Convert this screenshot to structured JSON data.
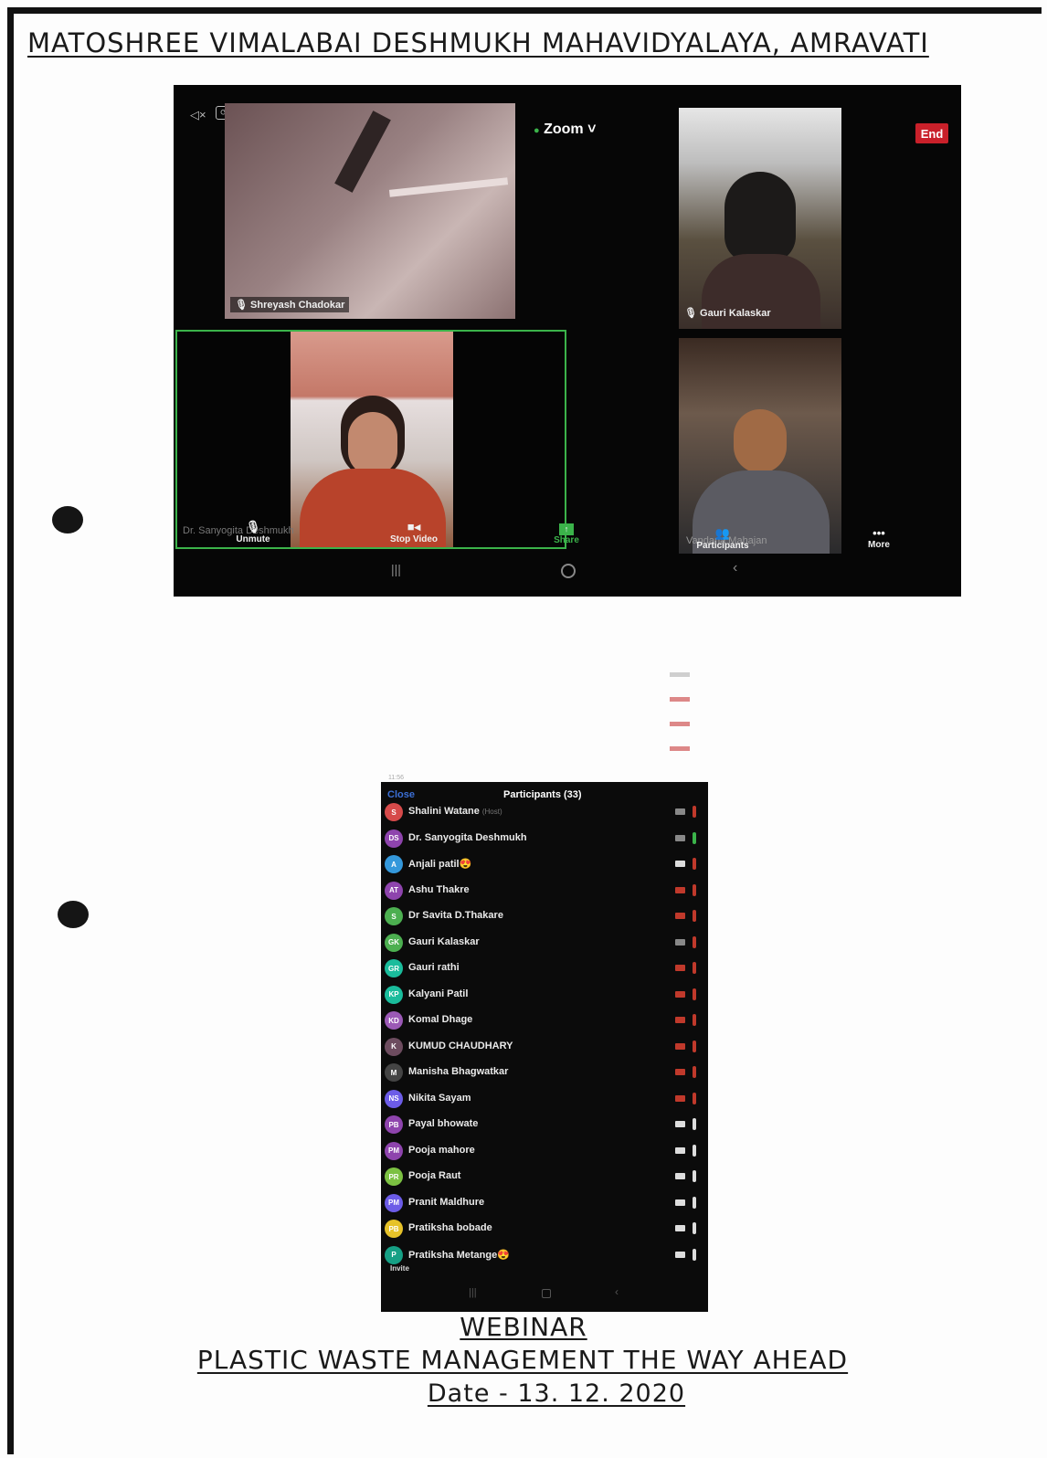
{
  "heading": "MATOSHREE VIMALABAI DESHMUKH MAHAVIDYALAYA, AMRAVATI",
  "zoom": {
    "app_label": "Zoom ˅",
    "end_label": "End",
    "tiles": {
      "t1_name": "Shreyash Chadokar",
      "t2_name": "Gauri Kalaskar",
      "t3_name": "Dr. Sanyogita Deshmukh",
      "t4_name": "Vandana Mahajan"
    },
    "toolbar": {
      "unmute": "Unmute",
      "stop_video": "Stop Video",
      "share": "Share",
      "participants": "Participants",
      "more": "More"
    }
  },
  "participants": {
    "close_label": "Close",
    "title": "Participants (33)",
    "invite_label": "Invite",
    "status_time": "11:56",
    "rows": [
      {
        "initials": "S",
        "name": "Shalini Watane",
        "tag": "(Host)",
        "color": "#d64a4a",
        "cam": "#888",
        "mic": "#c0392b"
      },
      {
        "initials": "DS",
        "name": "Dr. Sanyogita Deshmukh",
        "tag": "",
        "color": "#8e44ad",
        "cam": "#888",
        "mic": "#3bb34a"
      },
      {
        "initials": "A",
        "name": "Anjali patil😍",
        "tag": "",
        "color": "#3498db",
        "cam": "#ddd",
        "mic": "#c0392b"
      },
      {
        "initials": "AT",
        "name": "Ashu Thakre",
        "tag": "",
        "color": "#8e44ad",
        "cam": "#c0392b",
        "mic": "#c0392b"
      },
      {
        "initials": "S",
        "name": "Dr Savita D.Thakare",
        "tag": "",
        "color": "#4caf50",
        "cam": "#c0392b",
        "mic": "#c0392b"
      },
      {
        "initials": "GK",
        "name": "Gauri Kalaskar",
        "tag": "",
        "color": "#4caf50",
        "cam": "#888",
        "mic": "#c0392b"
      },
      {
        "initials": "GR",
        "name": "Gauri rathi",
        "tag": "",
        "color": "#1abc9c",
        "cam": "#c0392b",
        "mic": "#c0392b"
      },
      {
        "initials": "KP",
        "name": "Kalyani Patil",
        "tag": "",
        "color": "#1abc9c",
        "cam": "#c0392b",
        "mic": "#c0392b"
      },
      {
        "initials": "KD",
        "name": "Komal Dhage",
        "tag": "",
        "color": "#9b59b6",
        "cam": "#c0392b",
        "mic": "#c0392b"
      },
      {
        "initials": "K",
        "name": "KUMUD CHAUDHARY",
        "tag": "",
        "color": "#6d4c5f",
        "cam": "#c0392b",
        "mic": "#c0392b"
      },
      {
        "initials": "M",
        "name": "Manisha Bhagwatkar",
        "tag": "",
        "color": "#444",
        "cam": "#c0392b",
        "mic": "#c0392b"
      },
      {
        "initials": "NS",
        "name": "Nikita Sayam",
        "tag": "",
        "color": "#6c5ce7",
        "cam": "#c0392b",
        "mic": "#c0392b"
      },
      {
        "initials": "PB",
        "name": "Payal bhowate",
        "tag": "",
        "color": "#8e44ad",
        "cam": "#ddd",
        "mic": "#ddd"
      },
      {
        "initials": "PM",
        "name": "Pooja mahore",
        "tag": "",
        "color": "#8e44ad",
        "cam": "#ddd",
        "mic": "#ddd"
      },
      {
        "initials": "PR",
        "name": "Pooja Raut",
        "tag": "",
        "color": "#7cc142",
        "cam": "#ddd",
        "mic": "#ddd"
      },
      {
        "initials": "PM",
        "name": "Pranit Maldhure",
        "tag": "",
        "color": "#6c5ce7",
        "cam": "#ddd",
        "mic": "#ddd"
      },
      {
        "initials": "PB",
        "name": "Pratiksha bobade",
        "tag": "",
        "color": "#e6c229",
        "cam": "#ddd",
        "mic": "#ddd"
      },
      {
        "initials": "P",
        "name": "Pratiksha Metange😍",
        "tag": "",
        "color": "#16a085",
        "cam": "#ddd",
        "mic": "#ddd"
      }
    ]
  },
  "footer": {
    "line1": "WEBINAR",
    "line2": "PLASTIC WASTE MANAGEMENT THE WAY AHEAD",
    "line3": "Date - 13. 12. 2020"
  }
}
